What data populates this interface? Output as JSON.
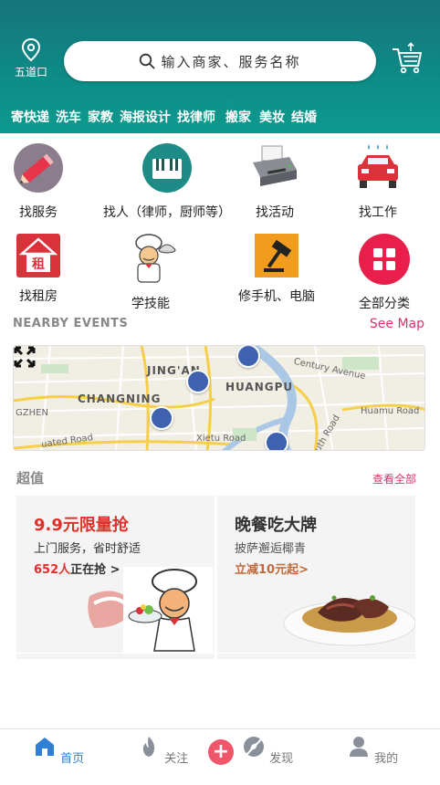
{
  "header": {
    "location_label": "五道口",
    "search_placeholder": "输入商家、服务名称",
    "categories": [
      "寄快递",
      "洗车",
      "家教",
      "海报设计",
      "找律师",
      "搬家",
      "美妆",
      "结婚"
    ]
  },
  "grid": [
    {
      "label": "找服务",
      "icon": "pencil-icon"
    },
    {
      "label": "找人（律师，厨师等）",
      "icon": "piano-icon"
    },
    {
      "label": "找活动",
      "icon": "printer-icon"
    },
    {
      "label": "找工作",
      "icon": "car-icon"
    },
    {
      "label": "找租房",
      "icon": "house-rent-icon"
    },
    {
      "label": "学技能",
      "icon": "chef-icon"
    },
    {
      "label": "修手机、电脑",
      "icon": "gavel-icon"
    },
    {
      "label": "全部分类",
      "icon": "all-categories-icon"
    }
  ],
  "nearby": {
    "title": "NEARBY EVENTS",
    "see_map": "See Map",
    "map_labels": {
      "jingan": "JING'AN",
      "changning": "CHANGNING",
      "huangpu": "HUANGPU",
      "zhen": "GZHEN",
      "century": "Century Avenue",
      "huamu": "Huamu Road",
      "xietu": "Xietu Road",
      "south": "South Road",
      "uated": "uated Road"
    }
  },
  "deals": {
    "title": "超值",
    "see_all": "查看全部",
    "cards": [
      {
        "title": "9.9元限量抢",
        "subtitle": "上门服务，省时舒适",
        "count": "652人",
        "meta_suffix": "正在抢 >",
        "title_color": "#e0302a"
      },
      {
        "title": "晚餐吃大牌",
        "subtitle": "披萨邂逅椰青",
        "meta": "立减10元起>",
        "title_color": "#333333"
      }
    ]
  },
  "tabs": [
    {
      "label": "首页",
      "icon": "home-icon",
      "active": true
    },
    {
      "label": "关注",
      "icon": "flame-icon",
      "active": false
    },
    {
      "label": "发现",
      "icon": "discover-icon",
      "active": false
    },
    {
      "label": "我的",
      "icon": "profile-icon",
      "active": false
    }
  ],
  "colors": {
    "header": "#0e8a86",
    "accent": "#e0306a",
    "active_tab": "#2f7fd6",
    "plus": "#f0566a"
  }
}
